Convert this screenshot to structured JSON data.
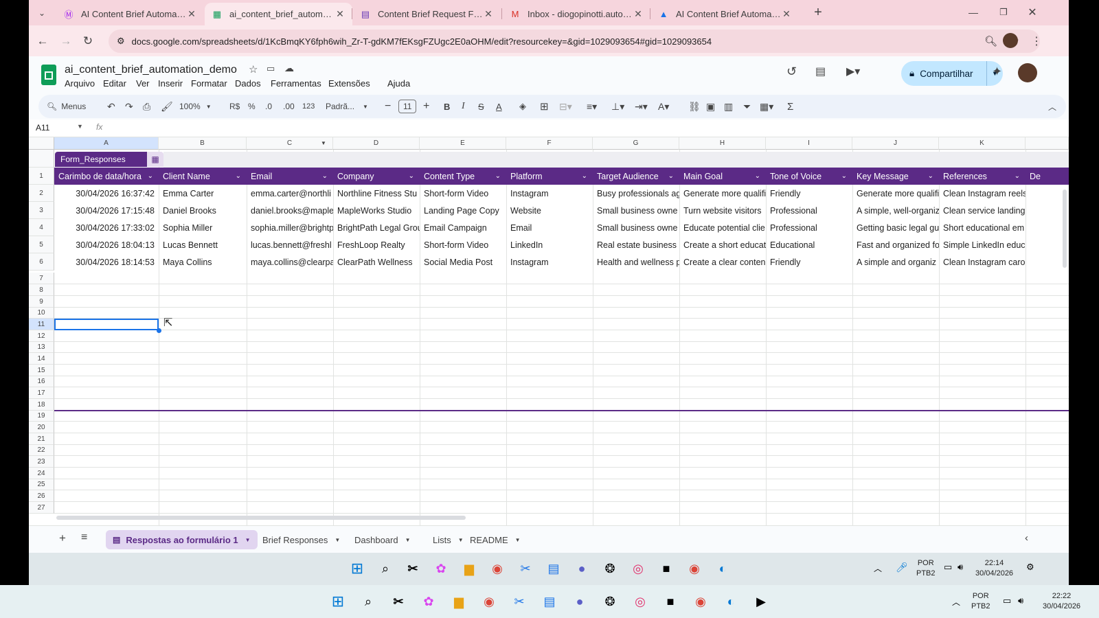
{
  "browser": {
    "tabs": [
      {
        "title": "AI Content Brief Automation | M",
        "icon": "make-icon",
        "color": "#a020f0"
      },
      {
        "title": "ai_content_brief_automation_d",
        "icon": "sheets-icon",
        "color": "#0f9d58"
      },
      {
        "title": "Content Brief Request Form",
        "icon": "forms-icon",
        "color": "#673ab7"
      },
      {
        "title": "Inbox - diogopinotti.automation",
        "icon": "gmail-icon",
        "color": "#d93025"
      },
      {
        "title": "AI Content Brief Automation - G",
        "icon": "drive-icon",
        "color": "#1a73e8"
      }
    ],
    "url": "docs.google.com/spreadsheets/d/1KcBmqKY6fph6wih_Zr-T-gdKM7fEKsgFZUgc2E0aOHM/edit?resourcekey=&gid=1029093654#gid=1029093654"
  },
  "doc": {
    "title": "ai_content_brief_automation_demo",
    "menus": [
      "Arquivo",
      "Editar",
      "Ver",
      "Inserir",
      "Formatar",
      "Dados",
      "Ferramentas",
      "Extensões",
      "Ajuda"
    ],
    "share_label": "Compartilhar"
  },
  "toolbar": {
    "menus_label": "Menus",
    "zoom": "100%",
    "currency": "R$",
    "percent": "%",
    "dec_minus": ".0",
    ".dec_plus": ".00",
    "number_format": "123",
    "font": "Padrã...",
    "font_size": "11"
  },
  "formula_bar": {
    "cell_ref": "A11",
    "fx": "fx",
    "content": ""
  },
  "grid": {
    "columns": [
      "A",
      "B",
      "C",
      "D",
      "E",
      "F",
      "G",
      "H",
      "I",
      "J",
      "K"
    ],
    "table_name": "Form_Responses",
    "headers": [
      "Carimbo de data/hora",
      "Client Name",
      "Email",
      "Company",
      "Content Type",
      "Platform",
      "Target Audience",
      "Main Goal",
      "Tone of Voice",
      "Key Message",
      "References",
      "De"
    ],
    "rows": [
      [
        "30/04/2026 16:37:42",
        "Emma Carter",
        "emma.carter@northli",
        "Northline Fitness Stu",
        "Short-form Video",
        "Instagram",
        "Busy professionals ag",
        "Generate more qualifi",
        "Friendly",
        "Generate more qualifi",
        "Clean Instagram reels"
      ],
      [
        "30/04/2026 17:15:48",
        "Daniel Brooks",
        "daniel.brooks@maple",
        "MapleWorks Studio",
        "Landing Page Copy",
        "Website",
        "Small business owne",
        "Turn website visitors",
        "Professional",
        "A simple, well-organiz",
        "Clean service landing"
      ],
      [
        "30/04/2026 17:33:02",
        "Sophia Miller",
        "sophia.miller@brightp",
        "BrightPath Legal Grou",
        "Email Campaign",
        "Email",
        "Small business owne",
        "Educate potential clie",
        "Professional",
        "Getting basic legal gu",
        "Short educational em"
      ],
      [
        "30/04/2026 18:04:13",
        "Lucas Bennett",
        "lucas.bennett@freshl",
        "FreshLoop Realty",
        "Short-form Video",
        "LinkedIn",
        "Real estate business",
        "Create a short educat",
        "Educational",
        "Fast and organized fo",
        "Simple LinkedIn educ"
      ],
      [
        "30/04/2026 18:14:53",
        "Maya Collins",
        "maya.collins@clearpa",
        "ClearPath Wellness",
        "Social Media Post",
        "Instagram",
        "Health and wellness p",
        "Create a clear conten",
        "Friendly",
        "A simple and organiz",
        "Clean Instagram caro"
      ]
    ],
    "row_numbers": [
      "1",
      "2",
      "3",
      "4",
      "5",
      "6",
      "7",
      "8",
      "9",
      "10",
      "11",
      "12",
      "13",
      "14",
      "15",
      "16",
      "17",
      "18",
      "19",
      "20",
      "21",
      "22",
      "23",
      "24",
      "25",
      "26",
      "27"
    ]
  },
  "sheets": [
    {
      "label": "Respostas ao formulário 1",
      "active": true
    },
    {
      "label": "Brief Responses",
      "active": false
    },
    {
      "label": "Dashboard",
      "active": false
    },
    {
      "label": "Lists",
      "active": false
    },
    {
      "label": "README",
      "active": false
    }
  ],
  "inner_taskbar": {
    "lang": "POR",
    "layout": "PTB2",
    "time": "22:14",
    "date": "30/04/2026"
  },
  "outer_taskbar": {
    "lang": "POR",
    "layout": "PTB2",
    "time": "22:22",
    "date": "30/04/2026"
  },
  "colors": {
    "accent": "#5b2a86",
    "share": "#c2e7ff",
    "selection": "#1a73e8"
  }
}
